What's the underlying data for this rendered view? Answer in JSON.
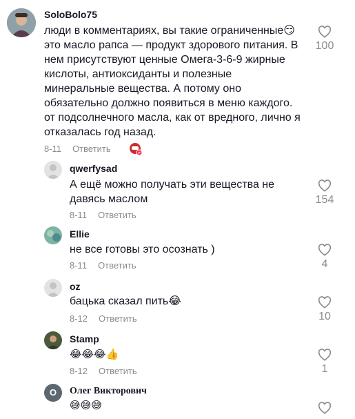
{
  "comments": [
    {
      "username": "SoloBolo75",
      "text": "люди в комментариях, вы такие ограниченные😏\nэто масло рапса — продукт здорового питания. В\nнем присутствуют ценные Омега-3-6-9 жирные\nкислоты, антиоксиданты и полезные\nминеральные вещества. А потому оно\nобязательно должно появиться в меню каждого.\nот подсолнечного масла, как от вредного, лично я\nотказалась год назад.",
      "date": "8-11",
      "reply_label": "Ответить",
      "likes": "100"
    },
    {
      "username": "qwerfysad",
      "text": "А ещё можно получать эти вещества не\nдавясь маслом",
      "date": "8-11",
      "reply_label": "Ответить",
      "likes": "154"
    },
    {
      "username": "Ellie",
      "text": "не все готовы это осознать )",
      "date": "8-11",
      "reply_label": "Ответить",
      "likes": "4"
    },
    {
      "username": "oz",
      "text": "бацька сказал пить😂",
      "date": "8-12",
      "reply_label": "Ответить",
      "likes": "10"
    },
    {
      "username": "Stamp",
      "text": "😂😂😂👍",
      "date": "8-12",
      "reply_label": "Ответить",
      "likes": "1"
    },
    {
      "username": "Олег Викторович",
      "avatar_letter": "О",
      "text": "😅😅😅",
      "likes": ""
    }
  ],
  "colors": {
    "muted": "#8a8b91",
    "text": "#161823",
    "heart": "#8a8b91"
  },
  "icons": {
    "like": "heart-outline-icon",
    "badge": "creator-liked-icon"
  }
}
